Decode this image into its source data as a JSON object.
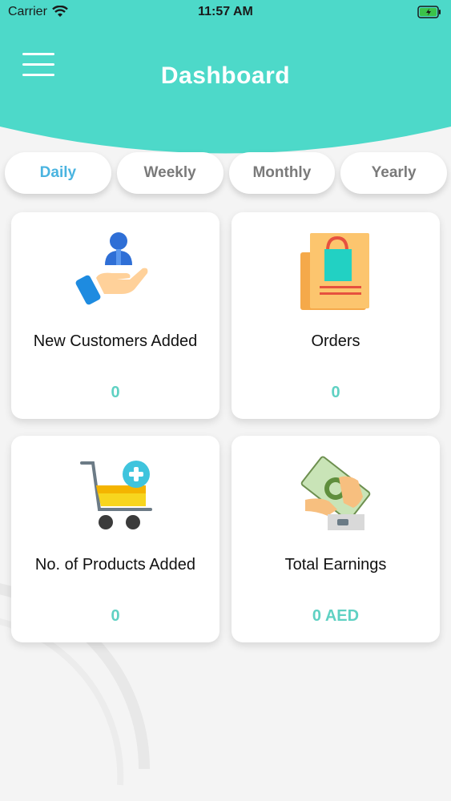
{
  "status": {
    "carrier": "Carrier",
    "time": "11:57 AM"
  },
  "header": {
    "title": "Dashboard",
    "color": "#4dd9c9"
  },
  "tabs": [
    {
      "label": "Daily",
      "active": true
    },
    {
      "label": "Weekly",
      "active": false
    },
    {
      "label": "Monthly",
      "active": false
    },
    {
      "label": "Yearly",
      "active": false
    }
  ],
  "cards": [
    {
      "label": "New Customers Added",
      "value": "0",
      "icon": "customer-hand-icon"
    },
    {
      "label": "Orders",
      "value": "0",
      "icon": "shopping-bag-receipt-icon"
    },
    {
      "label": "No. of Products Added",
      "value": "0",
      "icon": "cart-add-icon"
    },
    {
      "label": "Total Earnings",
      "value": "0 AED",
      "icon": "money-hand-icon"
    }
  ],
  "colors": {
    "accent": "#4ab4e0",
    "value": "#5fd1c3",
    "tab_inactive": "#7a7a7a"
  }
}
